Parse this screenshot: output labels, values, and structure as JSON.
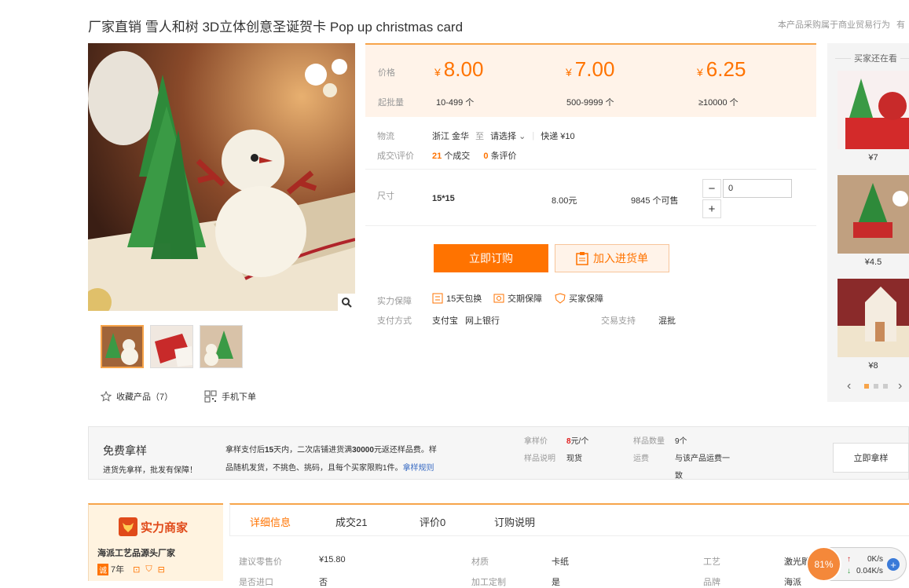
{
  "title": "厂家直销 雪人和树 3D立体创意圣诞贺卡 Pop up christmas card",
  "note": "本产品采购属于商业贸易行为",
  "note_extra": "有",
  "actions": {
    "favorite": "收藏产品（7）",
    "mobile": "手机下单"
  },
  "price": {
    "price_label": "价格",
    "moq_label": "起批量",
    "currency": "¥",
    "tiers": [
      {
        "price": "8.00",
        "range": "10-499 个"
      },
      {
        "price": "7.00",
        "range": "500-9999 个"
      },
      {
        "price": "6.25",
        "range": "≥10000 个"
      }
    ]
  },
  "logistics": {
    "label": "物流",
    "origin": "浙江 金华",
    "to": "至",
    "dest": "请选择",
    "express": "快递 ¥10"
  },
  "deals": {
    "label": "成交\\评价",
    "count": "21",
    "count_suffix": "个成交",
    "reviews": "0",
    "reviews_suffix": "条评价"
  },
  "sku": {
    "label": "尺寸",
    "size": "15*15",
    "price": "8.00元",
    "stock": "9845 个可售",
    "qty": "0",
    "minus": "−",
    "plus": "+"
  },
  "buttons": {
    "buy": "立即订购",
    "cart": "加入进货单"
  },
  "guarantee": {
    "label": "实力保障",
    "items": [
      "15天包换",
      "交期保障",
      "买家保障"
    ]
  },
  "payment": {
    "label": "支付方式",
    "alipay": "支付宝",
    "bank": "网上银行",
    "support_label": "交易支持",
    "support_value": "混批"
  },
  "sidebar": {
    "title": "买家还在看",
    "prices": [
      "¥7",
      "¥4.5",
      "¥8"
    ]
  },
  "sample": {
    "title": "免费拿样",
    "subtitle": "进货先拿样，批发有保障！",
    "desc_a": "拿样支付后",
    "desc_days": "15",
    "desc_b": "天内，二次店铺进货满",
    "desc_amount": "30000",
    "desc_c": "元返还样品费。样",
    "desc_line2": "品随机发货，不挑色、挑码，且每个买家限购1件。",
    "rules_link": "拿样规则",
    "price_label": "拿样价",
    "price_value": "8",
    "price_unit": "元/个",
    "desc_label": "样品说明",
    "desc_value": "现货",
    "qty_label": "样品数量",
    "qty_value": "9个",
    "ship_label": "运费",
    "ship_value_1": "与该产品运费一",
    "ship_value_2": "致",
    "button": "立即拿样"
  },
  "badge": {
    "title": "实力商家",
    "company": "海派工艺品源头厂家",
    "years": "7年",
    "year_icon": "诚"
  },
  "tabs": [
    "详细信息",
    "成交21",
    "评价0",
    "订购说明"
  ],
  "details": [
    {
      "label": "建议零售价",
      "value": "¥15.80"
    },
    {
      "label": "材质",
      "value": "卡纸"
    },
    {
      "label": "工艺",
      "value": "激光雕刻"
    }
  ],
  "details_row2": [
    {
      "label": "是否进口",
      "value": "否"
    },
    {
      "label": "加工定制",
      "value": "是"
    },
    {
      "label": "品牌",
      "value": "海派"
    }
  ],
  "speed": {
    "percent": "81%",
    "up": "0K/s",
    "down": "0.04K/s"
  },
  "colors": {
    "accent": "#ff7300",
    "light": "#fff3e9"
  }
}
